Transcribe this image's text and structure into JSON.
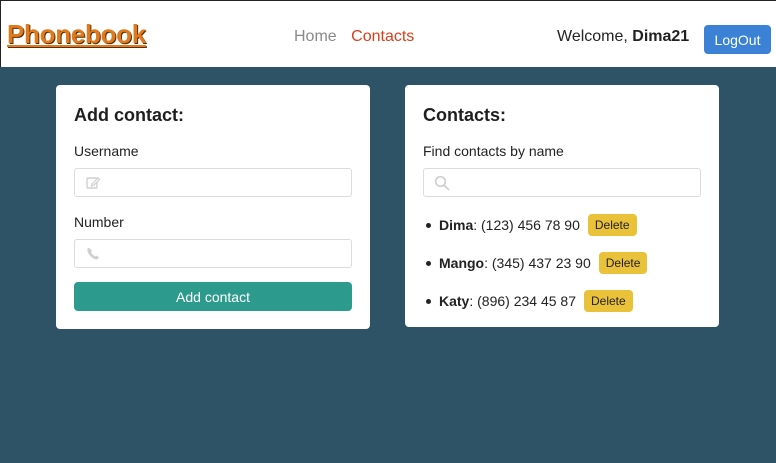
{
  "header": {
    "logo": "Phonebook",
    "nav": {
      "home": "Home",
      "contacts": "Contacts"
    },
    "welcome_prefix": "Welcome, ",
    "username": "Dima21",
    "logout_label": "LogOut"
  },
  "add_form": {
    "title": "Add contact:",
    "username_label": "Username",
    "username_value": "",
    "number_label": "Number",
    "number_value": "",
    "submit_label": "Add contact"
  },
  "contacts": {
    "title": "Contacts:",
    "filter_label": "Find contacts by name",
    "filter_value": "",
    "items": [
      {
        "name": "Dima",
        "sep": ": ",
        "number": "(123) 456 78 90",
        "delete_label": "Delete"
      },
      {
        "name": "Mango",
        "sep": ": ",
        "number": "(345) 437 23 90",
        "delete_label": "Delete"
      },
      {
        "name": "Katy",
        "sep": ": ",
        "number": "(896) 234 45 87",
        "delete_label": "Delete"
      }
    ]
  },
  "colors": {
    "page_bg": "#2e5366",
    "logo": "#e07a1c",
    "active_nav": "#d6401a",
    "logout_bg": "#3b82d6",
    "add_button_bg": "#2d9a8e",
    "delete_bg": "#eac23a"
  },
  "icons": {
    "username_field": "edit-icon",
    "number_field": "phone-icon",
    "filter_field": "search-icon"
  }
}
